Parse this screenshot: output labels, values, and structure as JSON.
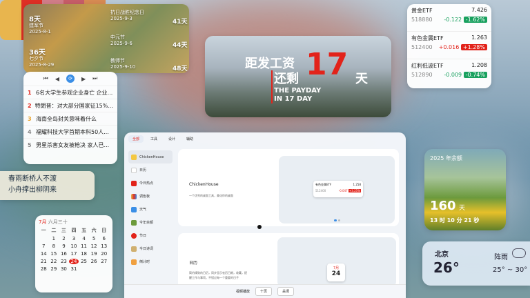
{
  "holiday": {
    "cells": [
      {
        "days": "8天",
        "name": "建军节",
        "date": "2025-8-1"
      },
      {
        "name": "抗日战胜纪念日",
        "date": "2025-9-3",
        "days": "41天"
      },
      {
        "days": "36天",
        "name": "七夕节",
        "date": "2025-8-29"
      },
      {
        "name": "中元节",
        "date": "2025-9-6",
        "days": "44天"
      },
      {
        "name": "教师节",
        "date": "2025-9-10",
        "days": "48天"
      }
    ]
  },
  "hotlist": {
    "controls": [
      "⏮",
      "◀",
      "▶",
      "⏭"
    ],
    "center_icon": "sync-icon",
    "items": [
      {
        "rank": "1",
        "text": "6名大学生参观企业身亡 企业..."
      },
      {
        "rank": "2",
        "text": "特朗普：对大部分国家征15%..."
      },
      {
        "rank": "3",
        "text": "海南全岛封关意味着什么"
      },
      {
        "rank": "4",
        "text": "福耀科技大学首期本科50人..."
      },
      {
        "rank": "5",
        "text": "男星杀害女友被枪决 家人已..."
      }
    ]
  },
  "payday": {
    "line1": "距发工资",
    "line2": "还剩",
    "number": "17",
    "unit": "天",
    "en1": "THE PAYDAY",
    "en2": "IN 17 DAY"
  },
  "stocks": [
    {
      "name": "黄金ETF",
      "price": "7.426",
      "code": "518880",
      "change": "-0.122",
      "pct": "-1.62%",
      "dir": "down"
    },
    {
      "name": "有色金属ETF",
      "price": "1.263",
      "code": "512400",
      "change": "+0.016",
      "pct": "+1.28%",
      "dir": "up"
    },
    {
      "name": "红利低波ETF",
      "price": "1.208",
      "code": "512890",
      "change": "-0.009",
      "pct": "-0.74%",
      "dir": "down"
    }
  ],
  "palette": [
    "#e8b54e",
    "#de2f25",
    "#d07d88",
    "#c65d68",
    "#d68a52"
  ],
  "spring": {
    "label": "2025 年余额",
    "days": "160",
    "unit": "天",
    "countdown": "13 时 10 分 21 秒"
  },
  "poem": {
    "line1": "春雨断桥人不渡",
    "line2": "小舟撑出柳阴来"
  },
  "calendar": {
    "month": "7月",
    "lunar": "六月三十",
    "weekdays": [
      "一",
      "二",
      "三",
      "四",
      "五",
      "六",
      "日"
    ],
    "days": [
      "",
      "1",
      "2",
      "3",
      "4",
      "5",
      "6",
      "7",
      "8",
      "9",
      "10",
      "11",
      "12",
      "13",
      "14",
      "15",
      "16",
      "17",
      "18",
      "19",
      "20",
      "21",
      "22",
      "23",
      "24",
      "25",
      "26",
      "27",
      "28",
      "29",
      "30",
      "31",
      "",
      "",
      "",
      ""
    ],
    "today": "24"
  },
  "window": {
    "tabs": [
      "全部",
      "工具",
      "设计",
      "辅助"
    ],
    "sidebar": [
      "ChickenHouse",
      "日历",
      "今日热点",
      "调色板",
      "天气",
      "今年余额",
      "节日",
      "今日诗词",
      "倒计时"
    ],
    "panel1": {
      "title": "ChickenHouse",
      "desc": "一个优秀的桌面工具，美化你的桌面"
    },
    "panel2": {
      "title": "日历",
      "desc1": "简约精致的日历，同步显示农历日期，收藏，提",
      "desc2": "醒工作与事项。不错过每一个重要的日子"
    },
    "mini_stock": {
      "name": "有色金属ETF",
      "price": "1.258",
      "code": "512400",
      "change": "-0.047",
      "pct": "+3.25%"
    },
    "mini_cal": {
      "month": "7月",
      "day": "24"
    },
    "bottom_label": "视频播放",
    "btn1": "十页",
    "btn2": "关闭"
  },
  "weather": {
    "city": "北京",
    "temp": "26°",
    "condition": "阵雨",
    "range": "25° ~ 30°"
  }
}
